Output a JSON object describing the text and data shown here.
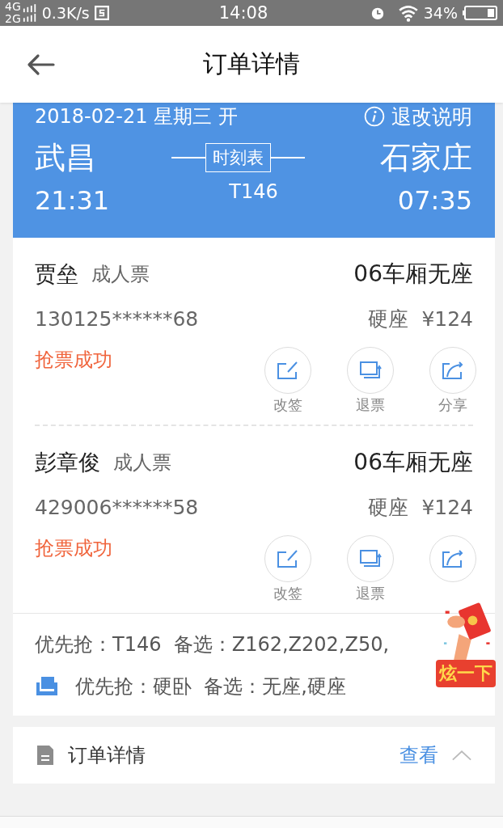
{
  "status_bar": {
    "network_1": "4G",
    "network_2": "2G",
    "speed": "0.3K/s",
    "time": "14:08",
    "battery": "34%"
  },
  "header": {
    "title": "订单详情"
  },
  "trip": {
    "date": "2018-02-21 星期三 开",
    "rules_link": "退改说明",
    "from_station": "武昌",
    "to_station": "石家庄",
    "timetable_button": "时刻表",
    "train": "T146",
    "depart": "21:31",
    "arrive": "07:35"
  },
  "passengers": [
    {
      "name": "贾垒",
      "ticket_type": "成人票",
      "carriage": "06车厢无座",
      "id_number": "130125******68",
      "seat_class": "硬座",
      "price": "¥124",
      "status": "抢票成功",
      "actions": [
        {
          "kind": "change",
          "label": "改签"
        },
        {
          "kind": "refund",
          "label": "退票"
        },
        {
          "kind": "share",
          "label": "分享"
        }
      ]
    },
    {
      "name": "彭章俊",
      "ticket_type": "成人票",
      "carriage": "06车厢无座",
      "id_number": "429006******58",
      "seat_class": "硬座",
      "price": "¥124",
      "status": "抢票成功",
      "actions": [
        {
          "kind": "change",
          "label": "改签"
        },
        {
          "kind": "refund",
          "label": "退票"
        },
        {
          "kind": "share"
        }
      ]
    }
  ],
  "preferences": {
    "train_line": "优先抢：T146  备选：Z162,Z202,Z50,",
    "seat_line": "优先抢：硬卧  备选：无座,硬座"
  },
  "order_section": {
    "title": "订单详情",
    "view_link": "查看",
    "expanded": true
  },
  "promo_badge": {
    "label": "炫一下"
  }
}
